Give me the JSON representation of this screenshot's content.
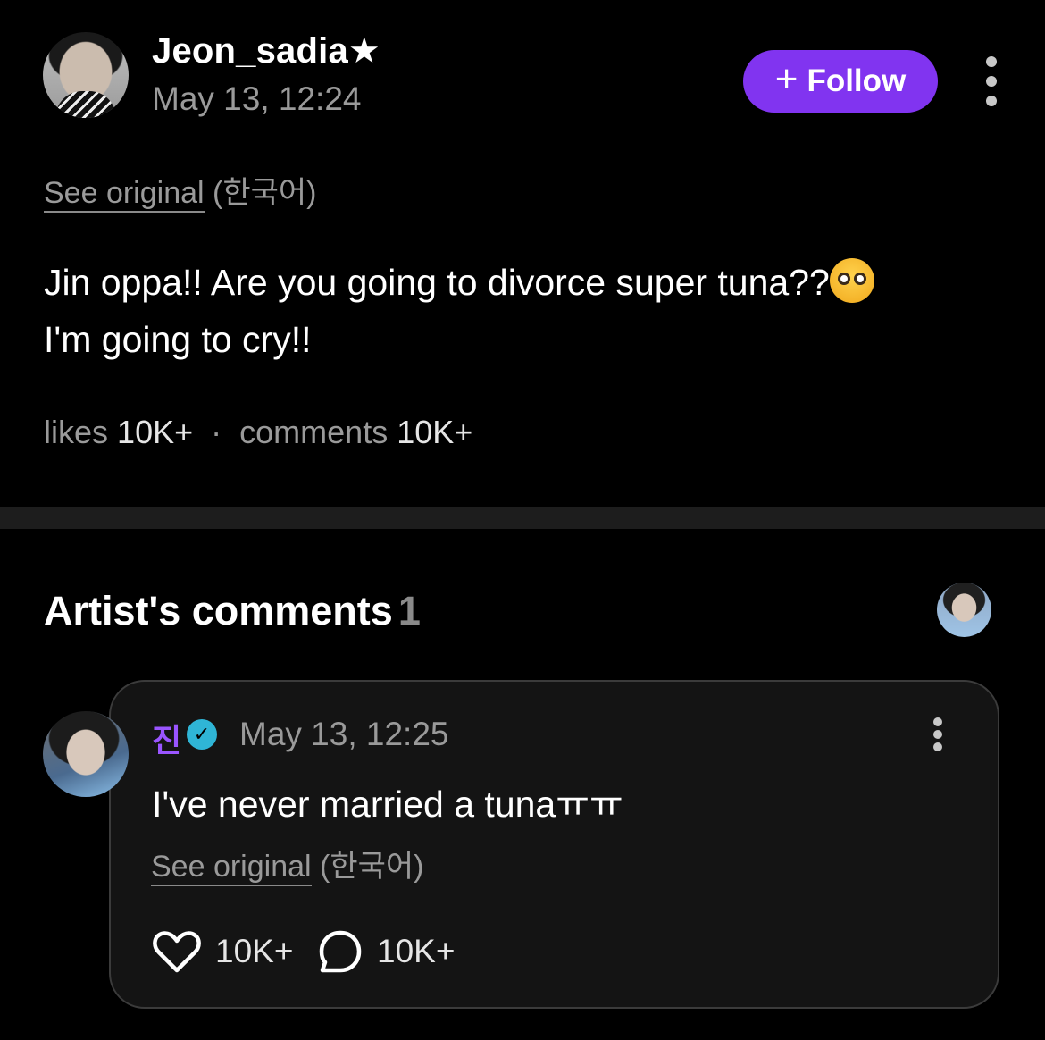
{
  "post": {
    "username": "Jeon_sadia★",
    "timestamp": "May 13, 12:24",
    "follow_label": "Follow",
    "see_original": "See original",
    "original_language": "(한국어)",
    "body_line1": "Jin oppa!! Are you going to divorce super tuna??",
    "body_line2": "I'm going to cry!!",
    "emoji": "pleading-face",
    "likes_label": "likes",
    "likes_count": "10K+",
    "separator": "·",
    "comments_label": "comments",
    "comments_count": "10K+"
  },
  "artist_comments": {
    "title": "Artist's comments",
    "count": "1",
    "comment": {
      "author": "진",
      "verified": true,
      "timestamp": "May 13, 12:25",
      "body": "I've never married a tunaㅠㅠ",
      "see_original": "See original",
      "original_language": "(한국어)",
      "likes": "10K+",
      "replies": "10K+"
    }
  },
  "colors": {
    "background": "#000000",
    "accent": "#8134f0",
    "author_name": "#9a55ff",
    "verified_badge": "#2fb5d6",
    "muted_text": "#9a9a9a"
  },
  "icons": [
    "more-vertical-icon",
    "plus-icon",
    "verified-badge-icon",
    "heart-icon",
    "speech-bubble-icon"
  ]
}
